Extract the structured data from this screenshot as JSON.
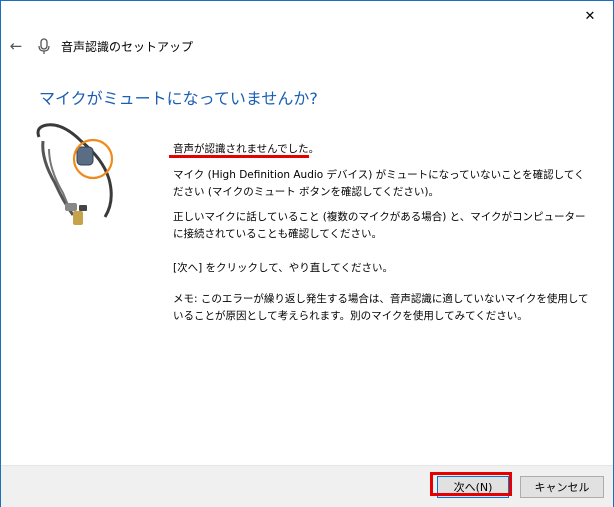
{
  "window": {
    "title": "音声認識のセットアップ",
    "close_glyph": "✕",
    "back_glyph": "←"
  },
  "page": {
    "heading": "マイクがミュートになっていませんか?",
    "error_title": "音声が認識されませんでした。",
    "paragraphs": [
      "マイク (High Definition Audio デバイス) がミュートになっていないことを確認してください (マイクのミュート ボタンを確認してください)。",
      "正しいマイクに話していること (複数のマイクがある場合) と、マイクがコンピューターに接続されていることも確認してください。",
      "[次へ] をクリックして、やり直してください。",
      "メモ: このエラーが繰り返し発生する場合は、音声認識に適していないマイクを使用していることが原因として考えられます。別のマイクを使用してみてください。"
    ]
  },
  "footer": {
    "next_label": "次へ(N)",
    "cancel_label": "キャンセル"
  },
  "colors": {
    "heading": "#1a5fb4",
    "annotation_red": "#e60000",
    "highlight_ring": "#f08a1c"
  }
}
